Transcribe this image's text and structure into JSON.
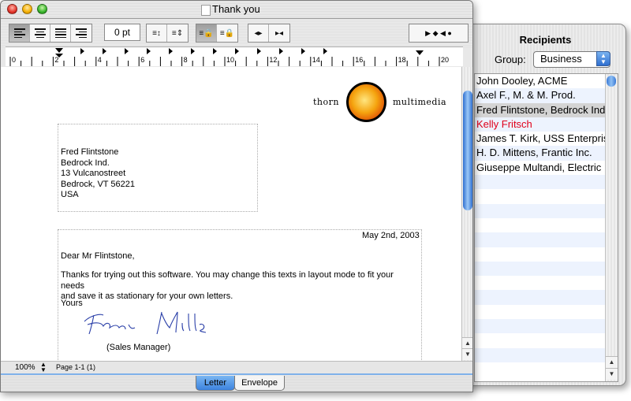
{
  "window": {
    "title": "Thank you"
  },
  "toolbar": {
    "spacing_value": "0 pt"
  },
  "ruler": {
    "labels": [
      "0",
      "2",
      "4",
      "6",
      "8",
      "10",
      "12",
      "14",
      "16",
      "18",
      "20"
    ]
  },
  "document": {
    "brand_left": "thorn",
    "brand_right": "multimedia",
    "address": "Fred Flintstone\nBedrock Ind.\n13 Vulcanostreet\nBedrock, VT 56221\nUSA",
    "date": "May 2nd, 2003",
    "salutation": "Dear Mr Flintstone,",
    "body": "Thanks for trying out this software. You may change this texts in layout mode to fit your needs\nand save it as stationary for your own letters.",
    "closing": "Yours",
    "signer_title": "(Sales Manager)"
  },
  "status": {
    "zoom": "100%",
    "page": "Page 1-1 (1)"
  },
  "tabs": [
    "Letter",
    "Envelope"
  ],
  "recipients": {
    "title": "Recipients",
    "group_label": "Group:",
    "group_value": "Business",
    "items": [
      "John Dooley, ACME",
      "Axel F., M. & M. Prod.",
      "Fred Flintstone, Bedrock Ind.",
      "Kelly Fritsch",
      "James T. Kirk, USS Enterprise",
      "H. D. Mittens, Frantic Inc.",
      "Giuseppe Multandi, Electric"
    ],
    "selected_index": 2,
    "highlight_index": 3
  },
  "colors": {
    "highlight_text": "#e0001a",
    "selection_blue": "#3d83de"
  }
}
